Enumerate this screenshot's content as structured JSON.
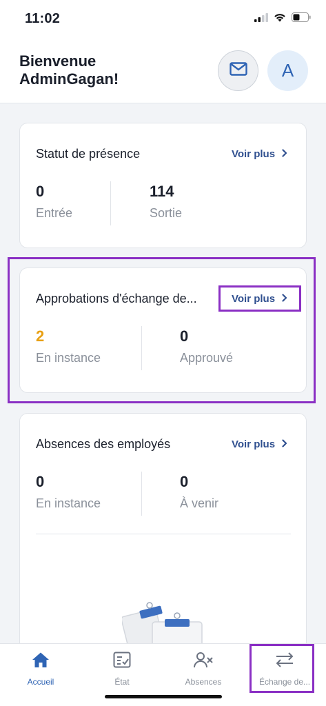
{
  "status_bar": {
    "time": "11:02"
  },
  "header": {
    "welcome_line1": "Bienvenue",
    "welcome_line2": "AdminGagan!",
    "avatar_initial": "A"
  },
  "cards": {
    "presence": {
      "title": "Statut de présence",
      "link": "Voir plus",
      "stats": [
        {
          "value": "0",
          "label": "Entrée"
        },
        {
          "value": "114",
          "label": "Sortie"
        }
      ]
    },
    "exchange": {
      "title": "Approbations d'échange de...",
      "link": "Voir plus",
      "stats": [
        {
          "value": "2",
          "label": "En instance"
        },
        {
          "value": "0",
          "label": "Approuvé"
        }
      ]
    },
    "absences": {
      "title": "Absences des employés",
      "link": "Voir plus",
      "stats": [
        {
          "value": "0",
          "label": "En instance"
        },
        {
          "value": "0",
          "label": "À venir"
        }
      ]
    }
  },
  "tabbar": {
    "items": [
      {
        "label": "Accueil",
        "icon": "home-icon",
        "active": true
      },
      {
        "label": "État",
        "icon": "checklist-icon",
        "active": false
      },
      {
        "label": "Absences",
        "icon": "user-x-icon",
        "active": false
      },
      {
        "label": "Échange de...",
        "icon": "swap-icon",
        "active": false
      }
    ]
  },
  "colors": {
    "accent": "#2f64b4",
    "link": "#2f4f8f",
    "pending": "#e8a013",
    "highlight": "#8a2fc4"
  }
}
